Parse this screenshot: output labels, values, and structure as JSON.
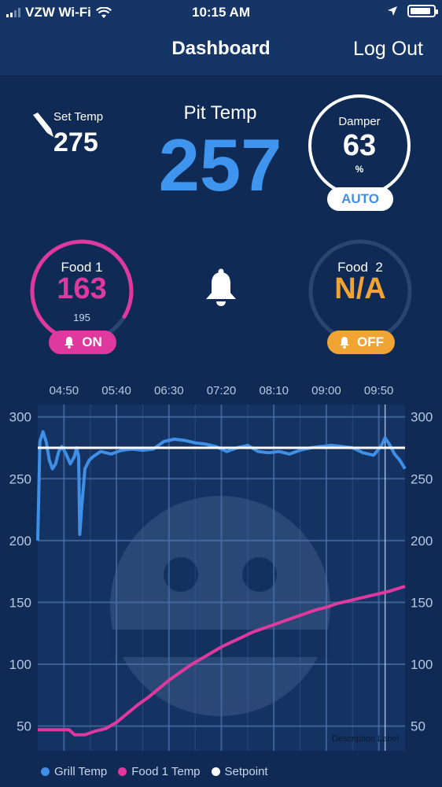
{
  "status_bar": {
    "carrier": "VZW Wi-Fi",
    "time": "10:15 AM",
    "battery_level": 0.9
  },
  "nav": {
    "title": "Dashboard",
    "logout_label": "Log Out"
  },
  "set_temp": {
    "label": "Set Temp",
    "value": "275"
  },
  "pit_temp": {
    "label": "Pit Temp",
    "value": "257"
  },
  "damper": {
    "label": "Damper",
    "value": "63",
    "unit": "%",
    "mode_label": "AUTO"
  },
  "food1": {
    "label": "Food 1",
    "value": "163",
    "target": "195",
    "alarm_label": "ON",
    "color": "#e0399e"
  },
  "food2": {
    "label": "Food  2",
    "value": "N/A",
    "alarm_label": "OFF",
    "color": "#f0a434"
  },
  "colors": {
    "grill": "#3f8fe6",
    "food1": "#e0399e",
    "setpoint": "#ffffff",
    "food2": "#f0a434"
  },
  "chart_data": {
    "type": "line",
    "x_ticks": [
      "04:50",
      "05:40",
      "06:30",
      "07:20",
      "08:10",
      "09:00",
      "09:50"
    ],
    "y_ticks_left": [
      "300",
      "250",
      "200",
      "150",
      "100",
      "50"
    ],
    "y_ticks_right": [
      "300",
      "250",
      "200",
      "150",
      "100",
      "50"
    ],
    "ylim": [
      30,
      310
    ],
    "xlim": [
      "04:25",
      "10:15"
    ],
    "annotation": "Description Label",
    "legend": [
      "Grill Temp",
      "Food 1 Temp",
      "Setpoint"
    ],
    "series": [
      {
        "name": "Grill Temp",
        "x": [
          "04:25",
          "04:27",
          "04:30",
          "04:33",
          "04:36",
          "04:39",
          "04:42",
          "04:45",
          "04:48",
          "04:52",
          "04:56",
          "05:00",
          "05:02",
          "05:04",
          "05:05",
          "05:07",
          "05:10",
          "05:14",
          "05:18",
          "05:25",
          "05:35",
          "05:45",
          "05:55",
          "06:05",
          "06:15",
          "06:25",
          "06:35",
          "06:45",
          "06:55",
          "07:05",
          "07:15",
          "07:25",
          "07:35",
          "07:45",
          "07:55",
          "08:05",
          "08:15",
          "08:25",
          "08:35",
          "08:45",
          "08:55",
          "09:05",
          "09:15",
          "09:25",
          "09:35",
          "09:45",
          "09:52",
          "09:56",
          "10:00",
          "10:05",
          "10:10",
          "10:15"
        ],
        "values": [
          200,
          280,
          288,
          280,
          265,
          258,
          262,
          272,
          276,
          270,
          262,
          268,
          275,
          268,
          205,
          228,
          258,
          265,
          268,
          272,
          270,
          273,
          274,
          273,
          274,
          280,
          282,
          281,
          279,
          278,
          276,
          272,
          275,
          277,
          272,
          271,
          272,
          270,
          273,
          275,
          276,
          277,
          276,
          275,
          271,
          269,
          276,
          283,
          278,
          270,
          265,
          258
        ]
      },
      {
        "name": "Food 1 Temp",
        "x": [
          "04:25",
          "04:35",
          "04:45",
          "04:55",
          "05:00",
          "05:10",
          "05:20",
          "05:30",
          "05:40",
          "05:50",
          "06:00",
          "06:10",
          "06:20",
          "06:30",
          "06:40",
          "06:50",
          "07:00",
          "07:10",
          "07:20",
          "07:30",
          "07:40",
          "07:50",
          "08:00",
          "08:10",
          "08:20",
          "08:30",
          "08:40",
          "08:50",
          "09:00",
          "09:10",
          "09:20",
          "09:30",
          "09:40",
          "09:50",
          "10:00",
          "10:15"
        ],
        "values": [
          47,
          47,
          47,
          47,
          43,
          43,
          46,
          48,
          53,
          60,
          67,
          73,
          80,
          87,
          93,
          99,
          104,
          109,
          114,
          118,
          122,
          126,
          129,
          132,
          135,
          138,
          141,
          144,
          146,
          149,
          151,
          153,
          155,
          157,
          159,
          163
        ]
      },
      {
        "name": "Setpoint",
        "x": [
          "04:25",
          "10:15"
        ],
        "values": [
          275,
          275
        ]
      }
    ]
  }
}
